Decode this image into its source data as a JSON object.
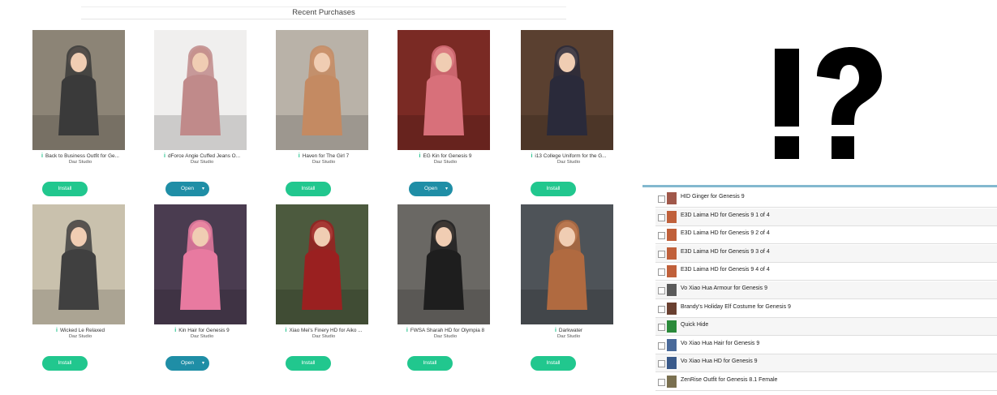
{
  "recent": {
    "header": "Recent Purchases",
    "items": [
      {
        "title": "Back to Business Outfit for Ge...",
        "sub": "Daz Studio",
        "button": "Install",
        "kind": "install",
        "bg": "#8c8476",
        "fg": "#3a3a3a"
      },
      {
        "title": "dForce Angie Cuffed Jeans O...",
        "sub": "Daz Studio",
        "button": "Open",
        "kind": "open",
        "bg": "#f0efee",
        "fg": "#c08a8a"
      },
      {
        "title": "Haven for The Girl 7",
        "sub": "Daz Studio",
        "button": "Install",
        "kind": "install",
        "bg": "#b9b2a8",
        "fg": "#c48a62"
      },
      {
        "title": "EG Kin for Genesis 9",
        "sub": "Daz Studio",
        "button": "Open",
        "kind": "open",
        "bg": "#7a2a24",
        "fg": "#d8707a"
      },
      {
        "title": "i13 College Uniform for the G...",
        "sub": "Daz Studio",
        "button": "Install",
        "kind": "install",
        "bg": "#5a4030",
        "fg": "#2a2a3a"
      },
      {
        "title": "Wicked Le Relaxed",
        "sub": "Daz Studio",
        "button": "Install",
        "kind": "install",
        "bg": "#c9c1ad",
        "fg": "#404040"
      },
      {
        "title": "Kin Hair for Genesis 9",
        "sub": "Daz Studio",
        "button": "Open",
        "kind": "open",
        "bg": "#4a3c50",
        "fg": "#e87aa0"
      },
      {
        "title": "Xiao Mei's Finery HD for Aiko ...",
        "sub": "Daz Studio",
        "button": "Install",
        "kind": "install",
        "bg": "#4c5a3e",
        "fg": "#9a2020"
      },
      {
        "title": "FWSA Sharah HD for Olympia 8",
        "sub": "Daz Studio",
        "button": "Install",
        "kind": "install",
        "bg": "#6a6864",
        "fg": "#1e1e1e"
      },
      {
        "title": "Darkwater",
        "sub": "Daz Studio",
        "button": "Install",
        "kind": "install",
        "bg": "#4e5358",
        "fg": "#b06a40"
      }
    ],
    "open_caret": "▾"
  },
  "bang": {
    "text": "!?"
  },
  "list": {
    "rows": [
      {
        "label": "HID Ginger for Genesis 9",
        "thumb": "#a0584a"
      },
      {
        "label": "E3D Laima HD for Genesis 9 1 of 4",
        "thumb": "#c0603a"
      },
      {
        "label": "E3D Laima HD for Genesis 9 2 of 4",
        "thumb": "#c0603a"
      },
      {
        "label": "E3D Laima HD for Genesis 9 3 of 4",
        "thumb": "#c0603a"
      },
      {
        "label": "E3D Laima HD for Genesis 9 4 of 4",
        "thumb": "#c0603a"
      },
      {
        "label": "Vo Xiao Hua Armour for Genesis 9",
        "thumb": "#5a5a5a"
      },
      {
        "label": "Brandy's Holiday Elf Costume for Genesis 9",
        "thumb": "#6a4030"
      },
      {
        "label": "Quick Hide",
        "thumb": "#2a8a3a"
      },
      {
        "label": "Vo Xiao Hua Hair for Genesis 9",
        "thumb": "#4a6a9a"
      },
      {
        "label": "Vo Xiao Hua HD for Genesis 9",
        "thumb": "#3a5a8a"
      },
      {
        "label": "ZenRise Outfit for Genesis 8.1 Female",
        "thumb": "#7a7050"
      }
    ]
  },
  "colors": {
    "install": "#21c78e",
    "open": "#1f8ea6",
    "accent": "#83b8cf"
  }
}
